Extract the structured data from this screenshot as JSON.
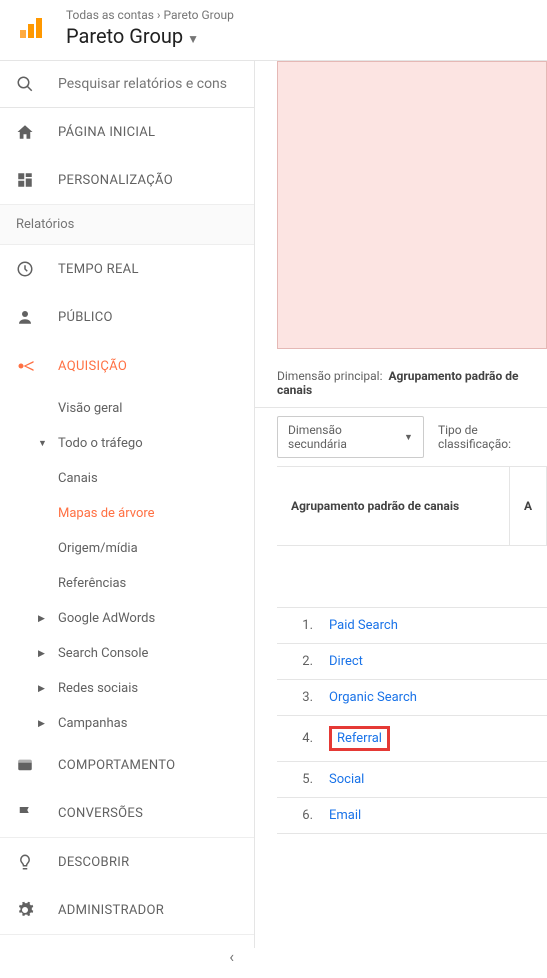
{
  "header": {
    "breadcrumb_all": "Todas as contas",
    "breadcrumb_sep": " › ",
    "breadcrumb_account": "Pareto Group",
    "account_name": "Pareto Group"
  },
  "search": {
    "placeholder": "Pesquisar relatórios e cons"
  },
  "nav": {
    "home": "PÁGINA INICIAL",
    "custom": "PERSONALIZAÇÃO",
    "reports_header": "Relatórios",
    "realtime": "TEMPO REAL",
    "audience": "PÚBLICO",
    "acquisition": "AQUISIÇÃO",
    "behavior": "COMPORTAMENTO",
    "conversions": "CONVERSÕES",
    "discover": "DESCOBRIR",
    "admin": "ADMINISTRADOR"
  },
  "acq_sub": {
    "overview": "Visão geral",
    "all_traffic": "Todo o tráfego",
    "channels": "Canais",
    "treemaps": "Mapas de árvore",
    "source_medium": "Origem/mídia",
    "referrals": "Referências",
    "adwords": "Google AdWords",
    "search_console": "Search Console",
    "social": "Redes sociais",
    "campaigns": "Campanhas"
  },
  "main": {
    "primary_dim_label": "Dimensão principal:",
    "primary_dim_value": "Agrupamento padrão de canais",
    "secondary_dim": "Dimensão secundária",
    "sort_label": "Tipo de classificação:",
    "col1": "Agrupamento padrão de canais",
    "col2": "A",
    "rows": [
      {
        "n": "1.",
        "name": "Paid Search"
      },
      {
        "n": "2.",
        "name": "Direct"
      },
      {
        "n": "3.",
        "name": "Organic Search"
      },
      {
        "n": "4.",
        "name": "Referral"
      },
      {
        "n": "5.",
        "name": "Social"
      },
      {
        "n": "6.",
        "name": "Email"
      }
    ]
  }
}
